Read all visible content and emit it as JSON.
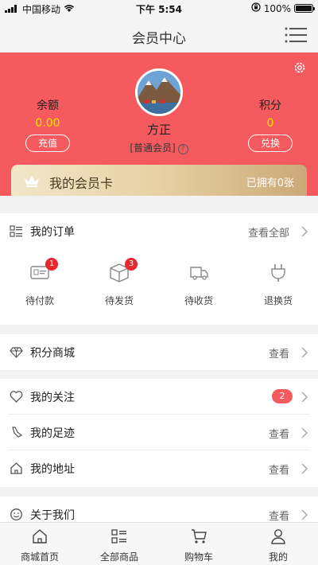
{
  "status_bar": {
    "carrier": "中国移动",
    "time": "下午 5:54",
    "battery": "100%"
  },
  "nav": {
    "title": "会员中心"
  },
  "profile": {
    "balance_label": "余额",
    "balance_value": "0.00",
    "recharge_label": "充值",
    "points_label": "积分",
    "points_value": "0",
    "exchange_label": "兑换",
    "name": "方正",
    "level": "[普通会员]",
    "help_mark": "?"
  },
  "vip_card": {
    "title": "我的会员卡",
    "count": "已拥有0张"
  },
  "orders": {
    "title": "我的订单",
    "view_all": "查看全部",
    "items": [
      {
        "label": "待付款",
        "badge": "1"
      },
      {
        "label": "待发货",
        "badge": "3"
      },
      {
        "label": "待收货",
        "badge": ""
      },
      {
        "label": "退换货",
        "badge": ""
      }
    ]
  },
  "points_mall": {
    "title": "积分商城",
    "action": "查看"
  },
  "follow": {
    "title": "我的关注",
    "badge": "2"
  },
  "footprints": {
    "title": "我的足迹",
    "action": "查看"
  },
  "address": {
    "title": "我的地址",
    "action": "查看"
  },
  "about": {
    "title": "关于我们",
    "action": "查看"
  },
  "tabbar": {
    "items": [
      {
        "label": "商城首页"
      },
      {
        "label": "全部商品"
      },
      {
        "label": "购物车"
      },
      {
        "label": "我的"
      }
    ]
  },
  "colors": {
    "header": "#f55b5e",
    "points_value": "#ffe400",
    "badge": "#e8282d"
  }
}
